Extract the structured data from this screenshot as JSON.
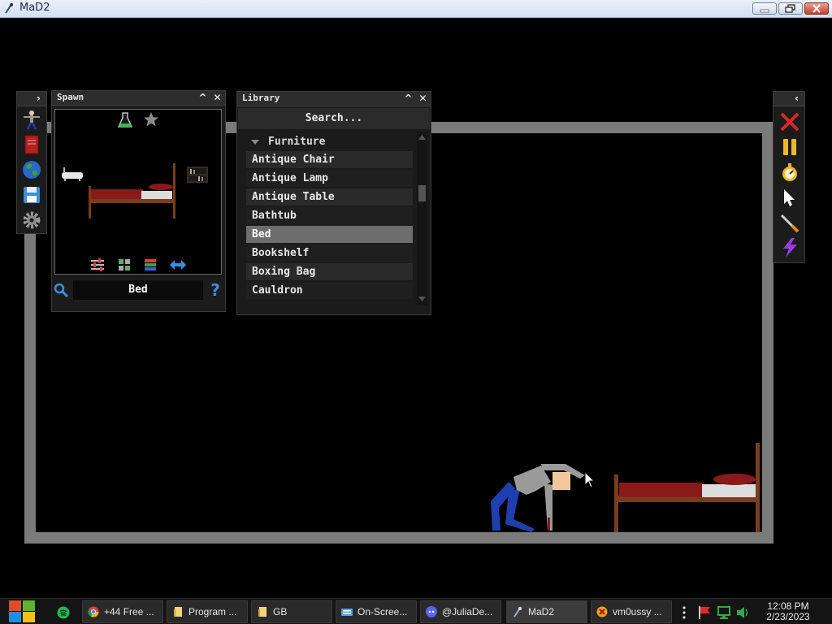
{
  "window": {
    "title": "MaD2"
  },
  "spawn_panel": {
    "title": "Spawn",
    "selected_item": "Bed",
    "help_label": "?"
  },
  "library_panel": {
    "title": "Library",
    "search_placeholder": "Search...",
    "category": "Furniture",
    "items": [
      {
        "label": "Antique Chair",
        "selected": false
      },
      {
        "label": "Antique Lamp",
        "selected": false
      },
      {
        "label": "Antique Table",
        "selected": false
      },
      {
        "label": "Bathtub",
        "selected": false
      },
      {
        "label": "Bed",
        "selected": true
      },
      {
        "label": "Bookshelf",
        "selected": false
      },
      {
        "label": "Boxing Bag",
        "selected": false
      },
      {
        "label": "Cauldron",
        "selected": false
      }
    ]
  },
  "left_toolbar": {
    "icons": [
      "ragdoll-icon",
      "book-icon",
      "globe-icon",
      "save-icon",
      "gear-icon"
    ]
  },
  "right_toolbar": {
    "icons": [
      "delete-icon",
      "pause-icon",
      "timer-icon",
      "cursor-icon",
      "knife-icon",
      "lightning-icon"
    ]
  },
  "taskbar": {
    "buttons": [
      {
        "label": "+44 Free ...",
        "icon": "chrome-icon"
      },
      {
        "label": "Program ...",
        "icon": "folder-icon"
      },
      {
        "label": "GB",
        "icon": "folder-icon"
      },
      {
        "label": "On-Scree...",
        "icon": "keyboard-icon"
      },
      {
        "label": "@JuliaDe...",
        "icon": "discord-icon"
      },
      {
        "label": "MaD2",
        "icon": "mad2-icon"
      },
      {
        "label": "vm0ussy ...",
        "icon": "app-icon"
      }
    ],
    "time": "12:08 PM",
    "date": "2/23/2023"
  },
  "colors": {
    "arena_wall": "#7a7a7a",
    "bed_frame": "#7a3c1c",
    "bed_blanket": "#8a1a1a",
    "selection": "#6d6d6d",
    "ragdoll_shirt": "#9a9a9a",
    "ragdoll_pants": "#1e3fb0"
  }
}
